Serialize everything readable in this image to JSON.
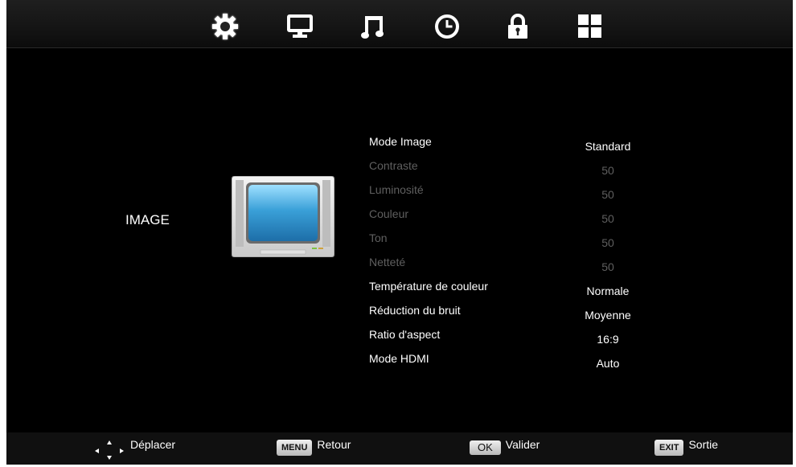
{
  "tabs": [
    {
      "icon": "gear-icon",
      "active": true
    },
    {
      "icon": "monitor-icon",
      "active": false
    },
    {
      "icon": "music-note-icon",
      "active": false
    },
    {
      "icon": "clock-icon",
      "active": false
    },
    {
      "icon": "lock-icon",
      "active": false
    },
    {
      "icon": "grid-icon",
      "active": false
    }
  ],
  "section": {
    "title": "IMAGE",
    "icon": "tv-icon"
  },
  "menu": {
    "items": [
      {
        "label": "Mode Image",
        "value": "Standard",
        "enabled": true
      },
      {
        "label": "Contraste",
        "value": "50",
        "enabled": false
      },
      {
        "label": "Luminosité",
        "value": "50",
        "enabled": false
      },
      {
        "label": "Couleur",
        "value": "50",
        "enabled": false
      },
      {
        "label": "Ton",
        "value": "50",
        "enabled": false
      },
      {
        "label": "Netteté",
        "value": "50",
        "enabled": false
      },
      {
        "label": "Température de couleur",
        "value": "Normale",
        "enabled": true
      },
      {
        "label": "Réduction du bruit",
        "value": "Moyenne",
        "enabled": true
      },
      {
        "label": "Ratio d'aspect",
        "value": "16:9",
        "enabled": true
      },
      {
        "label": "Mode HDMI",
        "value": "Auto",
        "enabled": true
      }
    ]
  },
  "footer": {
    "move": {
      "label": "Déplacer",
      "icon": "arrows-icon"
    },
    "menu": {
      "key": "MENU",
      "label": "Retour"
    },
    "ok": {
      "key": "OK",
      "label": "Valider"
    },
    "exit": {
      "key": "EXIT",
      "label": "Sortie"
    }
  },
  "colors": {
    "background": "#000000",
    "text": "#ffffff",
    "disabled_text": "#5f5f5f",
    "tv_screen": "#3aa0d8"
  }
}
